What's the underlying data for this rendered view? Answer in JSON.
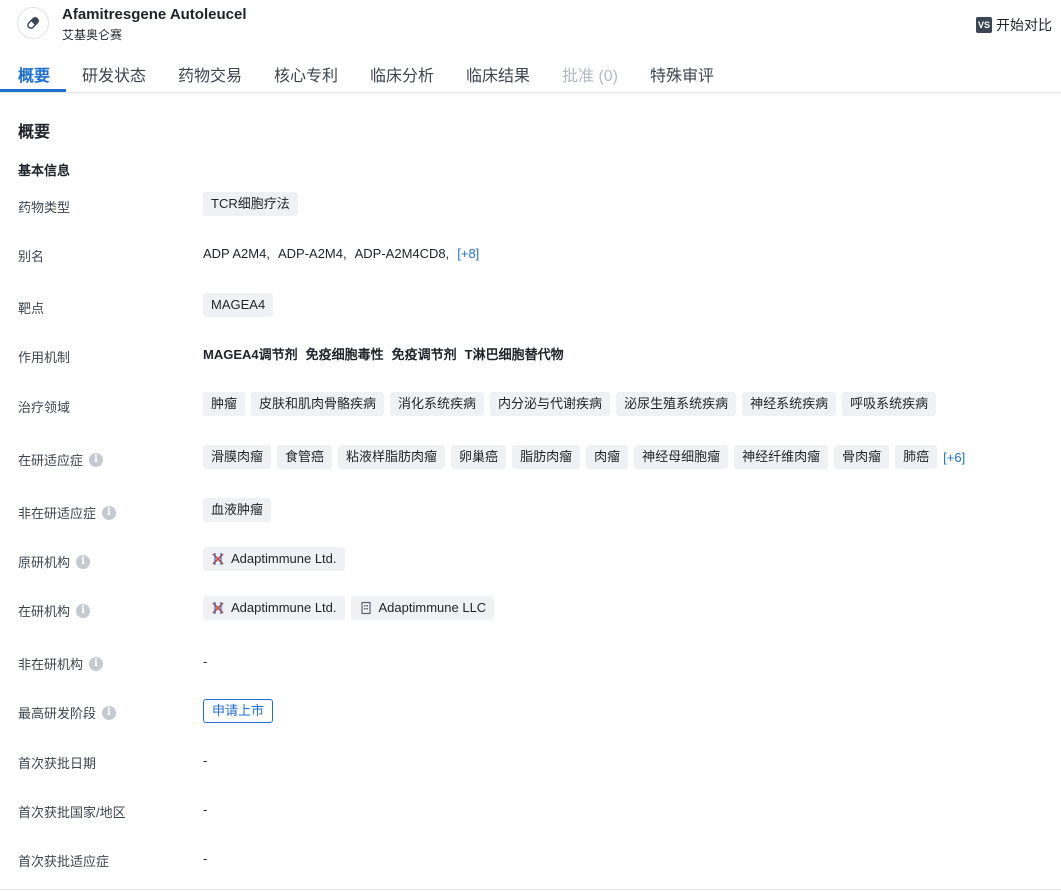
{
  "header": {
    "title": "Afamitresgene Autoleucel",
    "subtitle": "艾基奥仑赛",
    "drug_icon": "pill-icon",
    "compare_badge": "VS",
    "compare_label": "开始对比"
  },
  "tabs": [
    {
      "label": "概要",
      "state": "active"
    },
    {
      "label": "研发状态",
      "state": "normal"
    },
    {
      "label": "药物交易",
      "state": "normal"
    },
    {
      "label": "核心专利",
      "state": "normal"
    },
    {
      "label": "临床分析",
      "state": "normal"
    },
    {
      "label": "临床结果",
      "state": "normal"
    },
    {
      "label": "批准 (0)",
      "state": "disabled"
    },
    {
      "label": "特殊审评",
      "state": "normal"
    }
  ],
  "overview": {
    "section_title": "概要",
    "basic_info_title": "基本信息",
    "drug_type": {
      "label": "药物类型",
      "tags": [
        "TCR细胞疗法"
      ]
    },
    "aliases": {
      "label": "别名",
      "values": [
        "ADP A2M4,",
        "ADP-A2M4,",
        "ADP-A2M4CD8,"
      ],
      "more": "[+8]"
    },
    "target": {
      "label": "靶点",
      "tags": [
        "MAGEA4"
      ]
    },
    "mechanism": {
      "label": "作用机制",
      "values": [
        "MAGEA4调节剂",
        "免疫细胞毒性",
        "免疫调节剂",
        "T淋巴细胞替代物"
      ]
    },
    "therapeutic_area": {
      "label": "治疗领域",
      "tags": [
        "肿瘤",
        "皮肤和肌肉骨骼疾病",
        "消化系统疾病",
        "内分泌与代谢疾病",
        "泌尿生殖系统疾病",
        "神经系统疾病",
        "呼吸系统疾病"
      ]
    },
    "active_indications": {
      "label": "在研适应症",
      "tags": [
        "滑膜肉瘤",
        "食管癌",
        "粘液样脂肪肉瘤",
        "卵巢癌",
        "脂肪肉瘤",
        "肉瘤",
        "神经母细胞瘤",
        "神经纤维肉瘤",
        "骨肉瘤",
        "肺癌"
      ],
      "more": "[+6]"
    },
    "inactive_indications": {
      "label": "非在研适应症",
      "tags": [
        "血液肿瘤"
      ]
    },
    "originator": {
      "label": "原研机构",
      "orgs": [
        {
          "name": "Adaptimmune Ltd.",
          "logo": "adaptimmune-logo-icon"
        }
      ]
    },
    "active_orgs": {
      "label": "在研机构",
      "orgs": [
        {
          "name": "Adaptimmune Ltd.",
          "logo": "adaptimmune-logo-icon"
        },
        {
          "name": "Adaptimmune LLC",
          "logo": "building-icon"
        }
      ]
    },
    "inactive_orgs": {
      "label": "非在研机构",
      "value": "-"
    },
    "highest_phase": {
      "label": "最高研发阶段",
      "value": "申请上市"
    },
    "first_approval_date": {
      "label": "首次获批日期",
      "value": "-"
    },
    "first_approval_country": {
      "label": "首次获批国家/地区",
      "value": "-"
    },
    "first_approval_indication": {
      "label": "首次获批适应症",
      "value": "-"
    },
    "info_icon_glyph": "i"
  },
  "colors": {
    "accent": "#1e6fcf",
    "tag_bg": "#f0f1f4",
    "text": "#1f2329",
    "muted": "#3d4450"
  }
}
